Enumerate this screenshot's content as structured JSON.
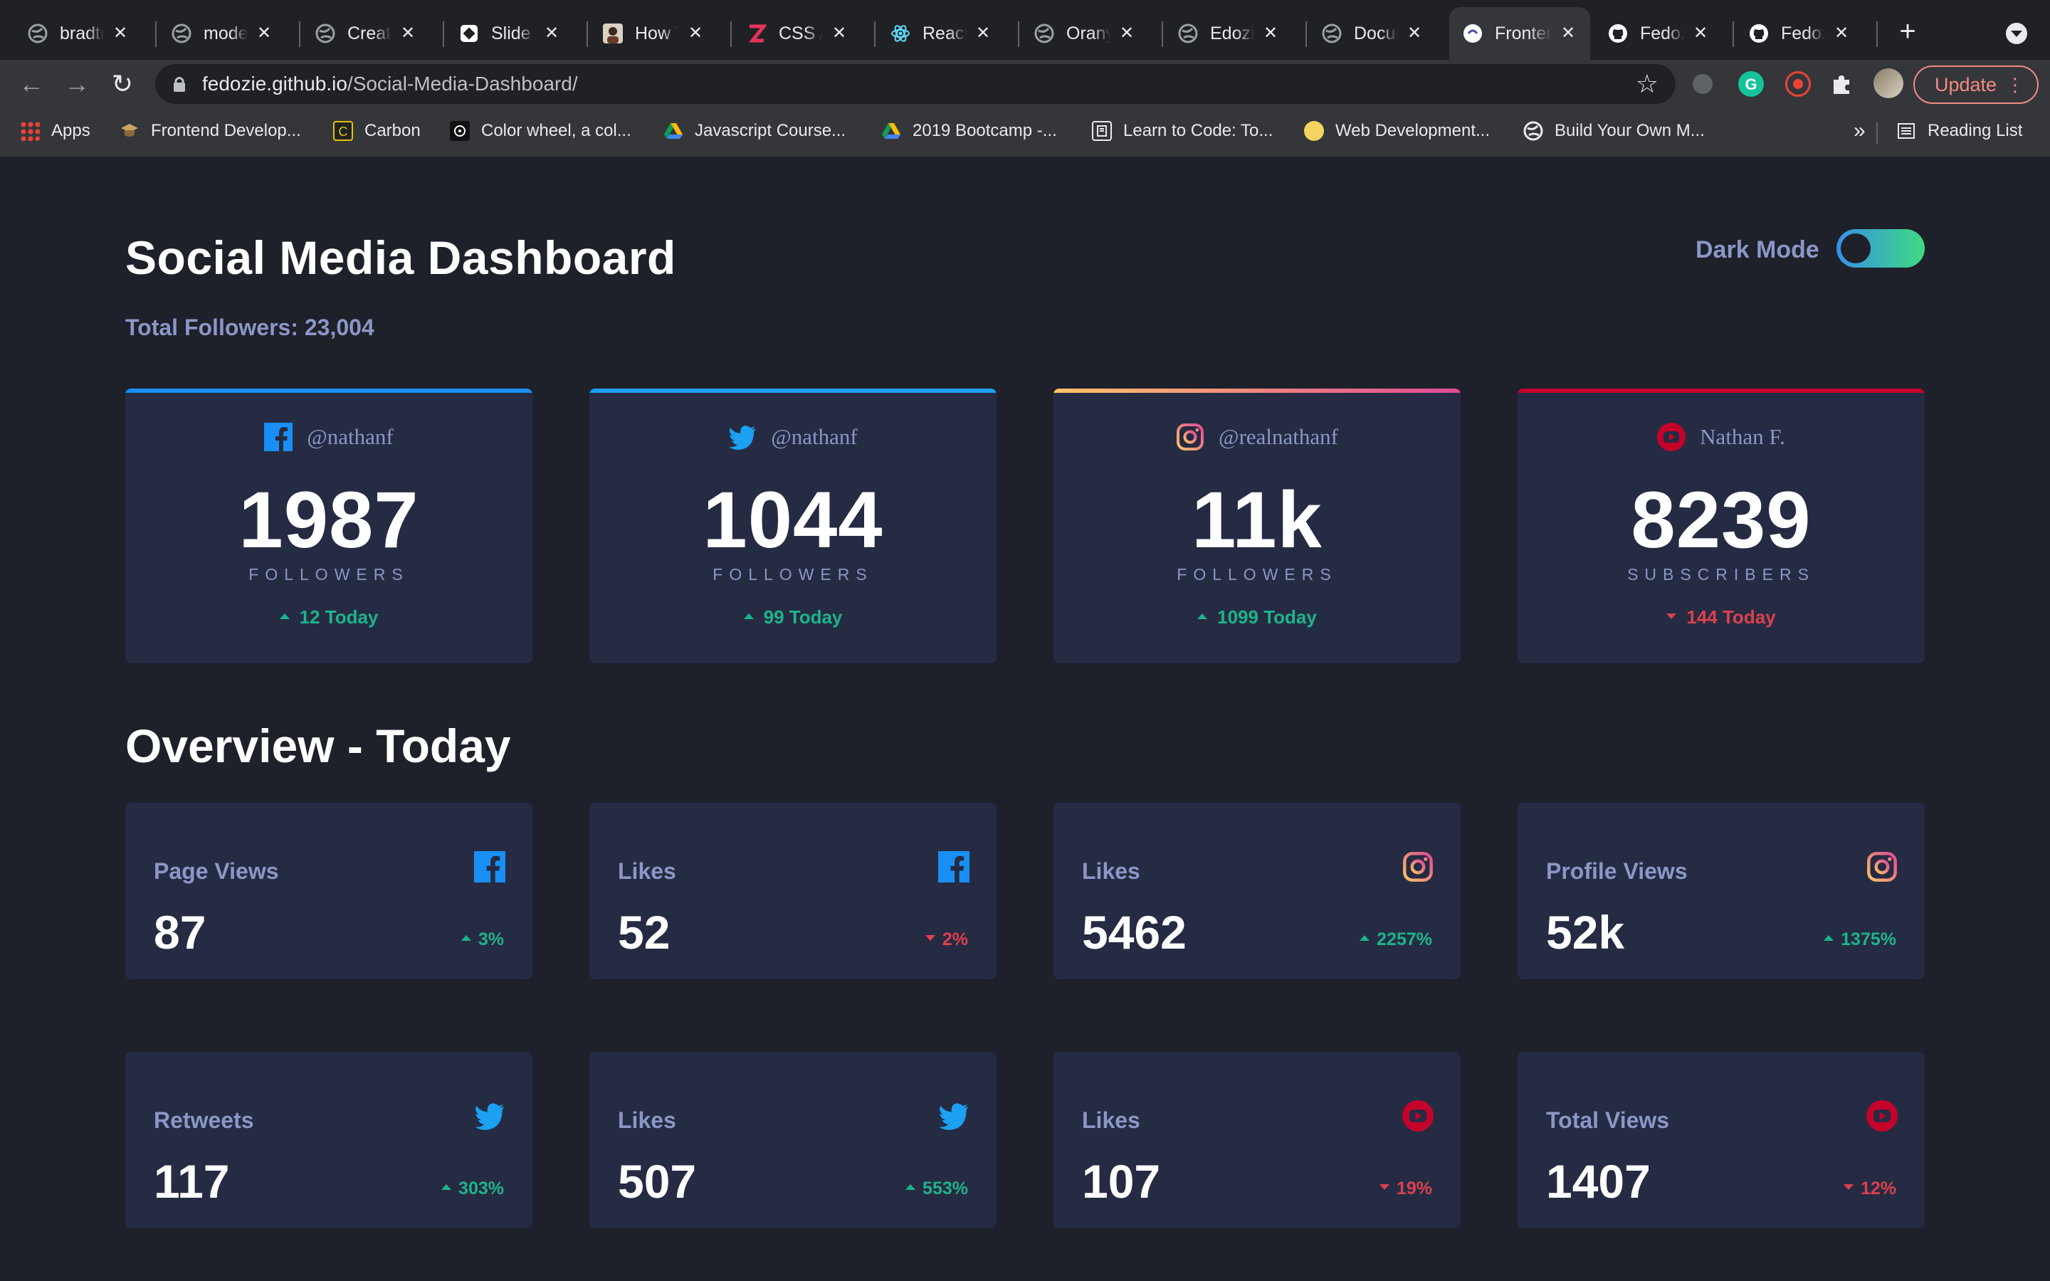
{
  "browser": {
    "tabs": [
      {
        "label": "bradtraversy",
        "icon": "globe-icon"
      },
      {
        "label": "modern",
        "icon": "globe-icon"
      },
      {
        "label": "Creating",
        "icon": "globe-icon"
      },
      {
        "label": "Slide S",
        "icon": "slides-icon"
      },
      {
        "label": "How To",
        "icon": "avatar-icon"
      },
      {
        "label": "CSS Animation",
        "icon": "z-icon"
      },
      {
        "label": "React",
        "icon": "react-icon"
      },
      {
        "label": "Oranye",
        "icon": "globe-icon"
      },
      {
        "label": "Edozie",
        "icon": "globe-icon"
      },
      {
        "label": "Document",
        "icon": "globe-icon"
      },
      {
        "label": "Frontend",
        "icon": "frontend-icon",
        "active": true
      },
      {
        "label": "Fedozie",
        "icon": "github-icon"
      },
      {
        "label": "Fedozie",
        "icon": "github-icon"
      }
    ],
    "url_host": "fedozie.github.io",
    "url_path": "/Social-Media-Dashboard/",
    "update_label": "Update",
    "bookmarks": [
      {
        "label": "Apps",
        "icon": "apps-grid-icon"
      },
      {
        "label": "Frontend Develop...",
        "icon": "grad-cap-icon"
      },
      {
        "label": "Carbon",
        "icon": "carbon-icon"
      },
      {
        "label": "Color wheel, a col...",
        "icon": "colorwheel-icon"
      },
      {
        "label": "Javascript Course...",
        "icon": "drive-icon"
      },
      {
        "label": "2019 Bootcamp -...",
        "icon": "drive-icon"
      },
      {
        "label": "Learn to Code: To...",
        "icon": "book-icon"
      },
      {
        "label": "Web Development...",
        "icon": "web-icon"
      },
      {
        "label": "Build Your Own M...",
        "icon": "globe-icon"
      }
    ],
    "bookmarks_overflow": "»",
    "reading_list": "Reading List"
  },
  "header": {
    "title": "Social Media Dashboard",
    "total_followers": "Total Followers: 23,004",
    "dark_mode_label": "Dark Mode",
    "dark_mode_on": true
  },
  "colors": {
    "background": "#1e202a",
    "card": "#252b43",
    "muted_text": "#8b97c6",
    "up": "#1db489",
    "down": "#dc414c",
    "facebook": "#198ff5",
    "twitter": "#1ca0f2",
    "instagram_gradient": [
      "#fdc468",
      "#df4996"
    ],
    "youtube": "#c4032a",
    "toggle_gradient": [
      "#378fe6",
      "#3eda82"
    ]
  },
  "cards": [
    {
      "platform": "facebook",
      "icon": "facebook-icon",
      "handle": "@nathanf",
      "count": "1987",
      "unit": "FOLLOWERS",
      "delta": "12 Today",
      "trend": "up"
    },
    {
      "platform": "twitter",
      "icon": "twitter-icon",
      "handle": "@nathanf",
      "count": "1044",
      "unit": "FOLLOWERS",
      "delta": "99 Today",
      "trend": "up"
    },
    {
      "platform": "instagram",
      "icon": "instagram-icon",
      "handle": "@realnathanf",
      "count": "11k",
      "unit": "FOLLOWERS",
      "delta": "1099 Today",
      "trend": "up"
    },
    {
      "platform": "youtube",
      "icon": "youtube-icon",
      "handle": "Nathan F.",
      "count": "8239",
      "unit": "SUBSCRIBERS",
      "delta": "144 Today",
      "trend": "down"
    }
  ],
  "overview": {
    "title": "Overview - Today",
    "items": [
      {
        "label": "Page Views",
        "icon": "facebook-icon",
        "value": "87",
        "delta": "3%",
        "trend": "up"
      },
      {
        "label": "Likes",
        "icon": "facebook-icon",
        "value": "52",
        "delta": "2%",
        "trend": "down"
      },
      {
        "label": "Likes",
        "icon": "instagram-icon",
        "value": "5462",
        "delta": "2257%",
        "trend": "up"
      },
      {
        "label": "Profile Views",
        "icon": "instagram-icon",
        "value": "52k",
        "delta": "1375%",
        "trend": "up"
      },
      {
        "label": "Retweets",
        "icon": "twitter-icon",
        "value": "117",
        "delta": "303%",
        "trend": "up"
      },
      {
        "label": "Likes",
        "icon": "twitter-icon",
        "value": "507",
        "delta": "553%",
        "trend": "up"
      },
      {
        "label": "Likes",
        "icon": "youtube-icon",
        "value": "107",
        "delta": "19%",
        "trend": "down"
      },
      {
        "label": "Total Views",
        "icon": "youtube-icon",
        "value": "1407",
        "delta": "12%",
        "trend": "down"
      }
    ]
  }
}
